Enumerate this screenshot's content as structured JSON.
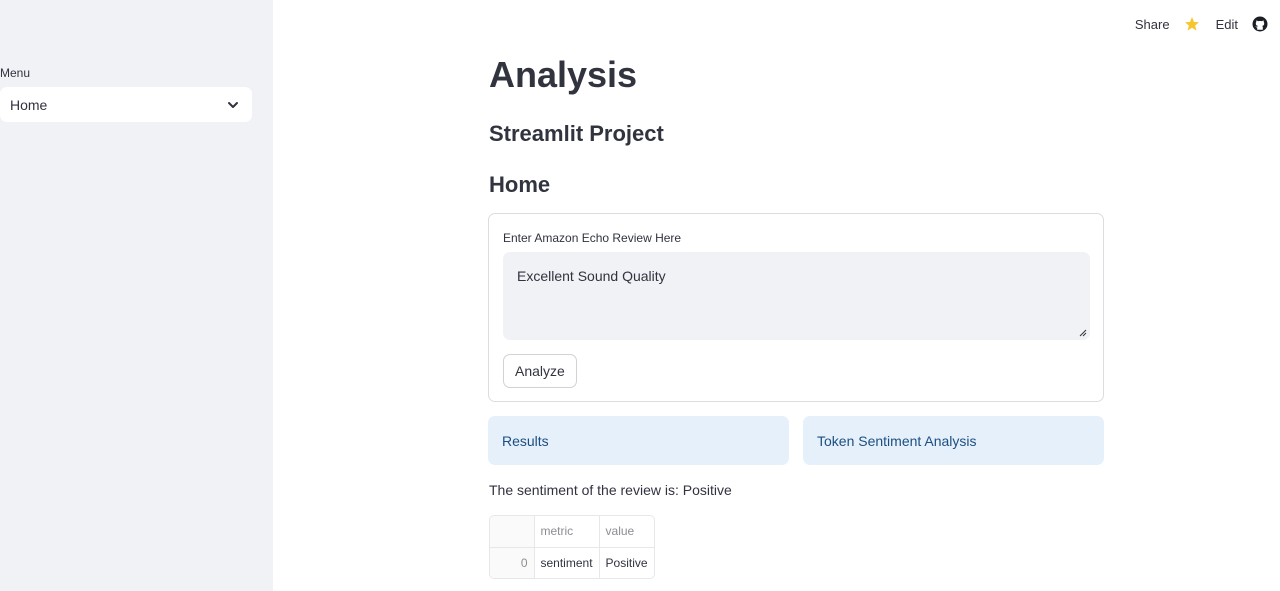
{
  "sidebar": {
    "menu_label": "Menu",
    "select_value": "Home"
  },
  "toolbar": {
    "share_label": "Share",
    "edit_label": "Edit",
    "star_color": "#f7c52c"
  },
  "main": {
    "title": "Analysis",
    "subtitle": "Streamlit Project",
    "section_title": "Home",
    "form": {
      "input_label": "Enter Amazon Echo Review Here",
      "input_value": "Excellent Sound Quality",
      "button_label": "Analyze"
    },
    "info_boxes": {
      "results": "Results",
      "token_analysis": "Token Sentiment Analysis"
    },
    "sentiment_text": "The sentiment of the review is: Positive",
    "dataframe": {
      "columns": [
        "metric",
        "value"
      ],
      "rows": [
        {
          "index": "0",
          "metric": "sentiment",
          "value": "Positive"
        }
      ]
    }
  },
  "colors": {
    "sidebar_bg": "#f0f2f6",
    "info_bg": "#e6f0fb",
    "info_text": "#1c4f80",
    "text": "#31333f"
  }
}
